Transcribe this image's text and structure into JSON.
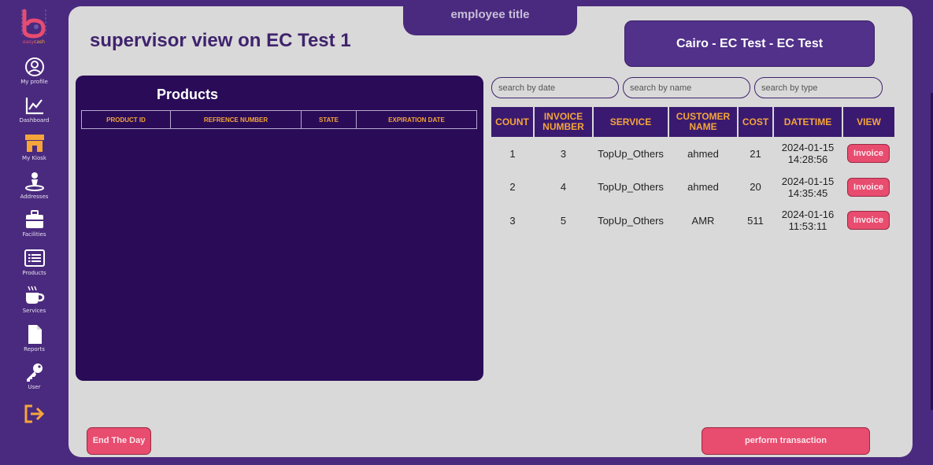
{
  "app": {
    "brand": {
      "part1": "easy",
      "part2": "cash"
    },
    "tab_title": "employee title",
    "page_title": "supervisor view on EC Test 1",
    "location": "Cairo - EC Test - EC Test"
  },
  "sidebar": {
    "items": [
      {
        "label": "My profile",
        "icon": "user-circle-icon"
      },
      {
        "label": "Dashboard",
        "icon": "chart-line-icon"
      },
      {
        "label": "My Kiosk",
        "icon": "store-icon"
      },
      {
        "label": "Addresses",
        "icon": "map-pin-icon"
      },
      {
        "label": "Facilities",
        "icon": "briefcase-icon"
      },
      {
        "label": "Products",
        "icon": "list-icon"
      },
      {
        "label": "Services",
        "icon": "coffee-icon"
      },
      {
        "label": "Reports",
        "icon": "file-icon"
      },
      {
        "label": "User",
        "icon": "key-icon"
      }
    ],
    "logout_icon": "logout-icon"
  },
  "products": {
    "title": "Products",
    "columns": [
      "PRODUCT ID",
      "REFRENCE NUMBER",
      "STATE",
      "EXPIRATION DATE"
    ]
  },
  "search": {
    "date_placeholder": "search by date",
    "name_placeholder": "search by name",
    "type_placeholder": "search by type"
  },
  "transactions": {
    "columns": [
      "COUNT",
      "INVOICE NUMBER",
      "SERVICE",
      "CUSTOMER NAME",
      "COST",
      "DATETIME",
      "VIEW"
    ],
    "rows": [
      {
        "count": "1",
        "invoice": "3",
        "service": "TopUp_Others",
        "customer": "ahmed",
        "cost": "21",
        "date": "2024-01-15",
        "time": "14:28:56",
        "view": "Invoice"
      },
      {
        "count": "2",
        "invoice": "4",
        "service": "TopUp_Others",
        "customer": "ahmed",
        "cost": "20",
        "date": "2024-01-15",
        "time": "14:35:45",
        "view": "Invoice"
      },
      {
        "count": "3",
        "invoice": "5",
        "service": "TopUp_Others",
        "customer": "AMR",
        "cost": "511",
        "date": "2024-01-16",
        "time": "11:53:11",
        "view": "Invoice"
      }
    ]
  },
  "actions": {
    "end_day": "End The Day",
    "perform": "perform transaction"
  },
  "colors": {
    "brand_purple": "#4a2a7e",
    "panel_dark": "#290b57",
    "accent_orange": "#f5a53a",
    "accent_pink": "#e84c6f",
    "background": "#d9d9d9"
  }
}
